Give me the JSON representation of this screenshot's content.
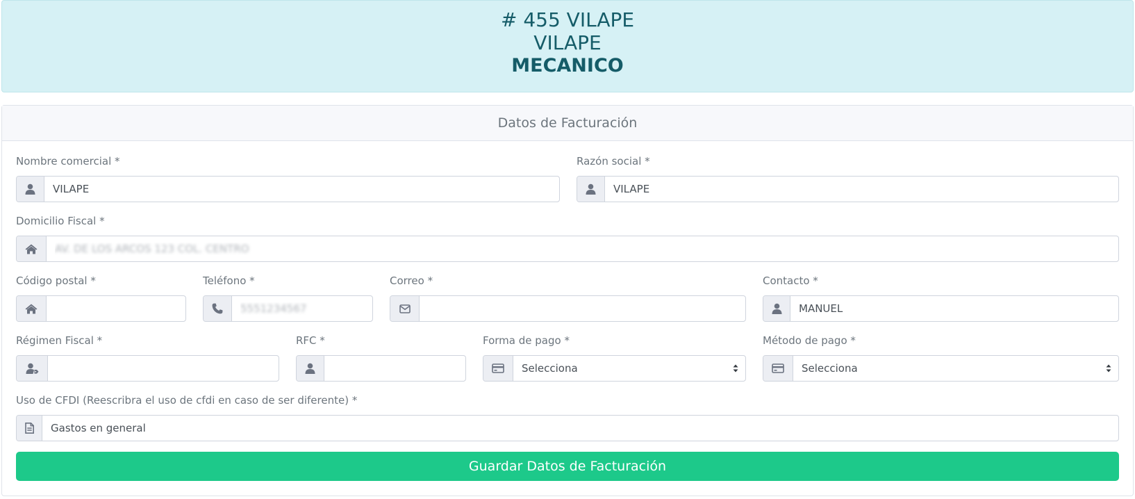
{
  "header": {
    "line1": "# 455 VILAPE",
    "line2": "VILAPE",
    "line3": "MECANICO"
  },
  "card": {
    "title": "Datos de Facturación"
  },
  "form": {
    "nombre_comercial": {
      "label": "Nombre comercial *",
      "value": "VILAPE"
    },
    "razon_social": {
      "label": "Razón social *",
      "value": "VILAPE"
    },
    "domicilio_fiscal": {
      "label": "Domicilio Fiscal *",
      "value": "AV. DE LOS ARCOS 123 COL. CENTRO"
    },
    "codigo_postal": {
      "label": "Código postal *",
      "value": ""
    },
    "telefono": {
      "label": "Teléfono *",
      "value": "5551234567"
    },
    "correo": {
      "label": "Correo *",
      "value": ""
    },
    "contacto": {
      "label": "Contacto *",
      "value": "MANUEL"
    },
    "regimen_fiscal": {
      "label": "Régimen Fiscal *",
      "value": ""
    },
    "rfc": {
      "label": "RFC *",
      "value": ""
    },
    "forma_pago": {
      "label": "Forma de pago *",
      "selected": "Selecciona"
    },
    "metodo_pago": {
      "label": "Método de pago *",
      "selected": "Selecciona"
    },
    "uso_cfdi": {
      "label": "Uso de CFDI (Reescribra el uso de cfdi en caso de ser diferente) *",
      "value": "Gastos en general"
    }
  },
  "save_button": {
    "label": "Guardar Datos de Facturación"
  },
  "icons": {
    "nombre_comercial": "user-icon",
    "razon_social": "user-icon",
    "domicilio_fiscal": "home-icon",
    "codigo_postal": "home-icon",
    "telefono": "phone-icon",
    "correo": "envelope-icon",
    "contacto": "user-icon",
    "regimen_fiscal": "user-tag-icon",
    "rfc": "user-icon",
    "forma_pago": "credit-card-icon",
    "metodo_pago": "credit-card-icon",
    "uso_cfdi": "file-icon"
  },
  "colors": {
    "header_bg": "#d6f1f5",
    "header_text": "#155c68",
    "button_bg": "#1dc98a"
  }
}
